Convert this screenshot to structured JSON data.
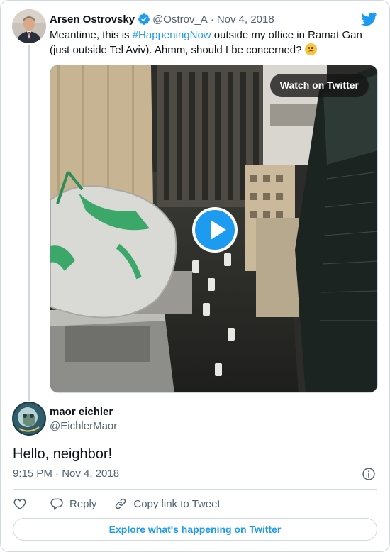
{
  "parent_tweet": {
    "author_name": "Arsen Ostrovsky",
    "handle": "@Ostrov_A",
    "separator": "·",
    "date": "Nov 4, 2018",
    "text_before": "Meantime, this is ",
    "hashtag": "#HappeningNow",
    "text_after": " outside my office in Ramat Gan (just outside Tel Aviv). Ahmm, should I be concerned? ",
    "emoji": "worried-face",
    "media": {
      "type": "video",
      "watch_label": "Watch on Twitter"
    }
  },
  "reply_tweet": {
    "author_name": "maor eichler",
    "handle": "@EichlerMaor",
    "text": "Hello, neighbor!",
    "timestamp": "9:15 PM · Nov 4, 2018"
  },
  "actions": {
    "like_icon": "heart-icon",
    "reply_label": "Reply",
    "copy_label": "Copy link to Tweet"
  },
  "explore_label": "Explore what's happening on Twitter",
  "colors": {
    "accent": "#1d9bf0",
    "text": "#0f1419",
    "secondary": "#536471",
    "border": "#cfd9de"
  }
}
